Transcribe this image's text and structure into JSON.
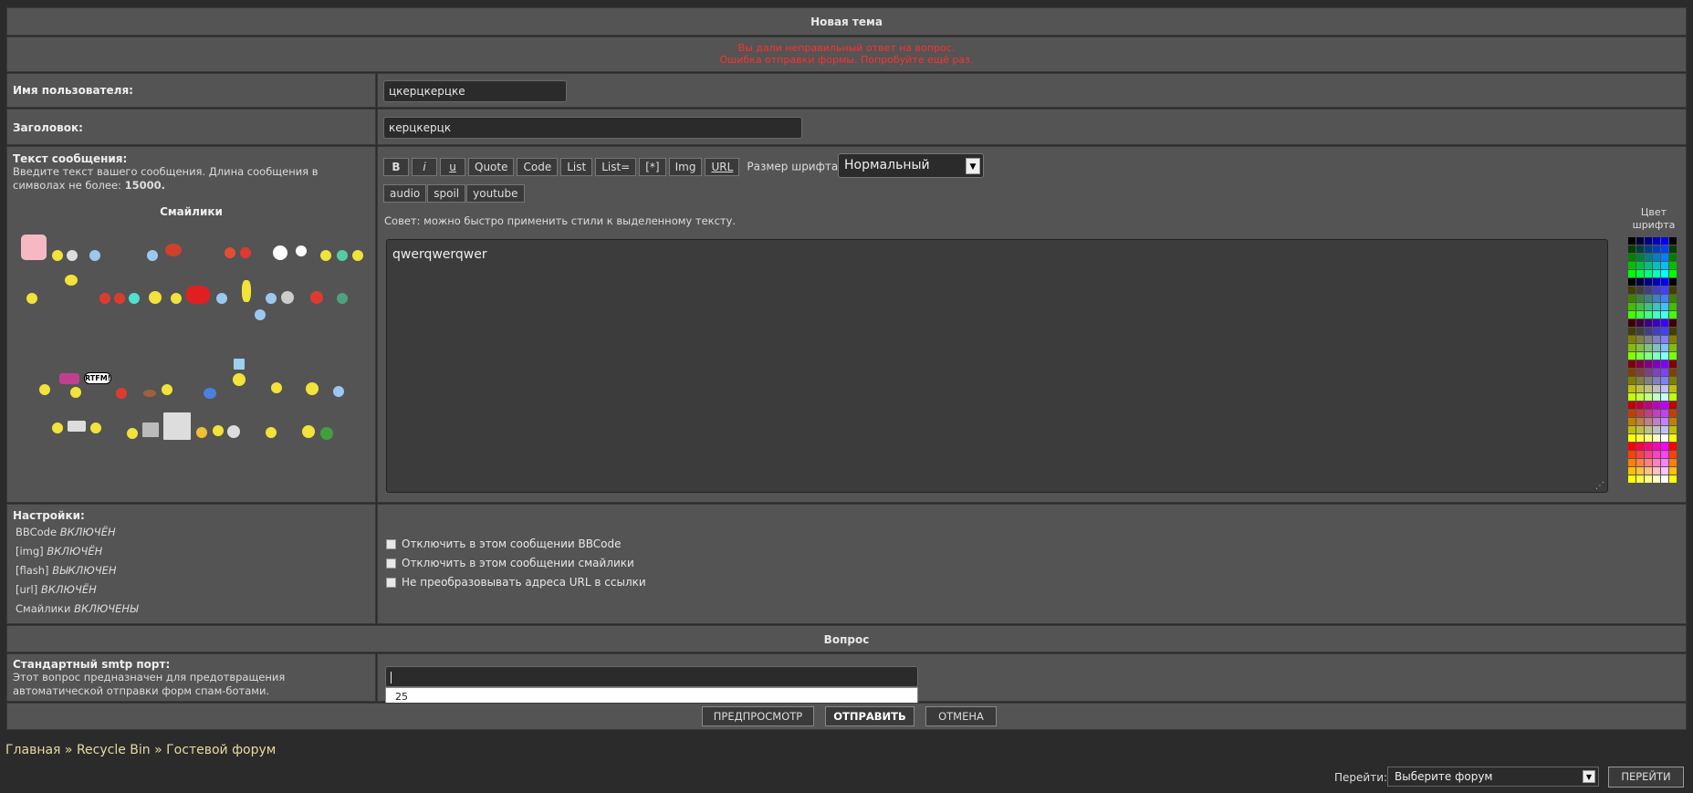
{
  "form": {
    "title": "Новая тема",
    "error_line1": "Вы дали неправильный ответ на вопрос.",
    "error_line2": "Ошибка отправки формы. Попробуйте ещё раз.",
    "username_label": "Имя пользователя:",
    "username_value": "цкерцкерцке",
    "subject_label": "Заголовок:",
    "subject_value": "керцкерцк",
    "message_label": "Текст сообщения:",
    "message_hint": "Введите текст вашего сообщения. Длина сообщения в символах не более: ",
    "message_limit": "15000.",
    "smilies_title": "Смайлики",
    "message_value": "qwerqwerqwer",
    "tip": "Совет: можно быстро применить стили к выделенному тексту."
  },
  "toolbar": {
    "buttons": [
      "B",
      "i",
      "u",
      "Quote",
      "Code",
      "List",
      "List=",
      "[*]",
      "Img",
      "URL"
    ],
    "font_size_label": "Размер шрифта:",
    "font_size_value": "Нормальный",
    "buttons2": [
      "audio",
      "spoil",
      "youtube"
    ]
  },
  "color_panel": {
    "title_line1": "Цвет",
    "title_line2": "шрифта"
  },
  "settings": {
    "label": "Настройки:",
    "items": [
      {
        "name": "BBCode",
        "state": "ВКЛЮЧЁН"
      },
      {
        "name": "[img]",
        "state": "ВКЛЮЧЁН"
      },
      {
        "name": "[flash]",
        "state": "ВЫКЛЮЧЕН"
      },
      {
        "name": "[url]",
        "state": "ВКЛЮЧЁН"
      },
      {
        "name": "Смайлики",
        "state": "ВКЛЮЧЕНЫ"
      }
    ],
    "options": [
      "Отключить в этом сообщении BBCode",
      "Отключить в этом сообщении смайлики",
      "Не преобразовывать адреса URL в ссылки"
    ]
  },
  "question": {
    "title": "Вопрос",
    "label": "Стандартный smtp порт:",
    "hint": "Этот вопрос предназначен для предотвращения автоматической отправки форм спам-ботами.",
    "answer_value": "",
    "autocomplete_value": "25"
  },
  "actions": {
    "preview": "ПРЕДПРОСМОТР",
    "submit": "ОТПРАВИТЬ",
    "cancel": "ОТМЕНА"
  },
  "breadcrumb": {
    "home": "Главная",
    "sep1": " » ",
    "item1": "Recycle Bin",
    "sep2": " » ",
    "item2": "Гостевой форум"
  },
  "jump": {
    "label": "Перейти:",
    "select_value": "Выберите форум",
    "button": "ПЕРЕЙТИ"
  },
  "colors": {
    "error": "#ff3030",
    "link": "#e6d9a0"
  }
}
